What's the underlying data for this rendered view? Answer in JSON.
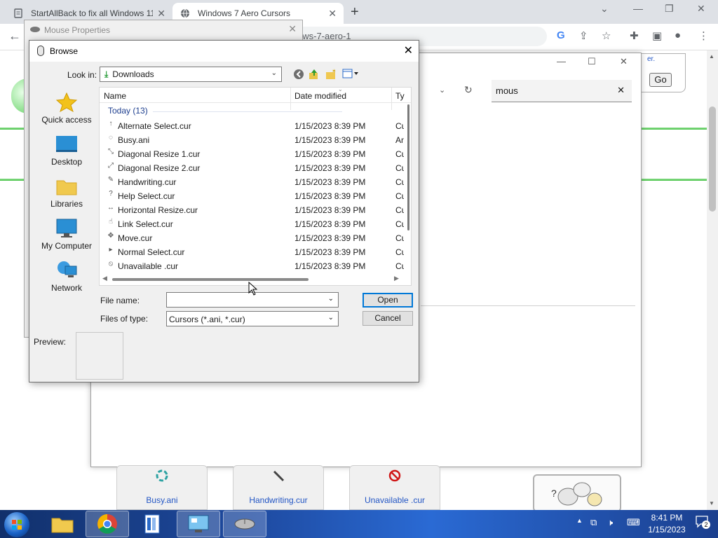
{
  "browser": {
    "tabs": [
      {
        "title": "StartAllBack to fix all Windows 11",
        "icon": "document-icon",
        "active": false
      },
      {
        "title": "Windows 7 Aero Cursors",
        "icon": "globe-icon",
        "active": true
      }
    ],
    "address_fragment": "ows-7-aero-1",
    "new_tab_glyph": "+",
    "toolbar_icons": [
      "google-icon",
      "share-icon",
      "star-icon",
      "extensions-icon",
      "sidepanel-icon",
      "profile-icon",
      "menu-icon"
    ]
  },
  "page": {
    "go_label": "Go",
    "search_fragment": "g",
    "cursor_tiles": [
      {
        "label": "Busy.ani",
        "icon": "busy-cursor-icon"
      },
      {
        "label": "Handwriting.cur",
        "icon": "pen-cursor-icon"
      },
      {
        "label": "Unavailable .cur",
        "icon": "unavailable-cursor-icon"
      }
    ],
    "link_fragment": "er."
  },
  "settings_window": {
    "search_value": "mous"
  },
  "mouse_properties": {
    "title": "Mouse Properties"
  },
  "browse": {
    "title": "Browse",
    "look_in_label": "Look in:",
    "look_in_value": "Downloads",
    "places": [
      {
        "label": "Quick access",
        "icon": "star-icon"
      },
      {
        "label": "Desktop",
        "icon": "desktop-icon"
      },
      {
        "label": "Libraries",
        "icon": "folder-icon"
      },
      {
        "label": "My Computer",
        "icon": "computer-icon"
      },
      {
        "label": "Network",
        "icon": "network-icon"
      }
    ],
    "columns": {
      "name": "Name",
      "date": "Date modified",
      "type": "Ty"
    },
    "group": "Today (13)",
    "files": [
      {
        "name": "Alternate Select.cur",
        "date": "1/15/2023 8:39 PM",
        "type": "Cu",
        "icon": "↑"
      },
      {
        "name": "Busy.ani",
        "date": "1/15/2023 8:39 PM",
        "type": "An",
        "icon": "◌"
      },
      {
        "name": "Diagonal Resize 1.cur",
        "date": "1/15/2023 8:39 PM",
        "type": "Cu",
        "icon": "⤡"
      },
      {
        "name": "Diagonal Resize 2.cur",
        "date": "1/15/2023 8:39 PM",
        "type": "Cu",
        "icon": "⤢"
      },
      {
        "name": "Handwriting.cur",
        "date": "1/15/2023 8:39 PM",
        "type": "Cu",
        "icon": "✎"
      },
      {
        "name": "Help Select.cur",
        "date": "1/15/2023 8:39 PM",
        "type": "Cu",
        "icon": "?"
      },
      {
        "name": "Horizontal Resize.cur",
        "date": "1/15/2023 8:39 PM",
        "type": "Cu",
        "icon": "↔"
      },
      {
        "name": "Link Select.cur",
        "date": "1/15/2023 8:39 PM",
        "type": "Cu",
        "icon": "☝"
      },
      {
        "name": "Move.cur",
        "date": "1/15/2023 8:39 PM",
        "type": "Cu",
        "icon": "✥"
      },
      {
        "name": "Normal Select.cur",
        "date": "1/15/2023 8:39 PM",
        "type": "Cu",
        "icon": "▸"
      },
      {
        "name": "Unavailable .cur",
        "date": "1/15/2023 8:39 PM",
        "type": "Cu",
        "icon": "⦸"
      }
    ],
    "file_name_label": "File name:",
    "file_name_value": "",
    "files_of_type_label": "Files of type:",
    "files_of_type_value": "Cursors (*.ani, *.cur)",
    "open_label": "Open",
    "cancel_label": "Cancel",
    "preview_label": "Preview:"
  },
  "taskbar": {
    "time": "8:41 PM",
    "date": "1/15/2023",
    "notification_count": "2",
    "apps": [
      "file-explorer-icon",
      "chrome-icon",
      "library-icon",
      "control-panel-icon",
      "mouse-icon"
    ]
  },
  "colors": {
    "dialog_bg": "#f0f0f0",
    "group_header": "#1e3f8f",
    "default_button_border": "#0078d7",
    "page_link": "#2255c4",
    "taskbar": "#1e4aa0"
  }
}
